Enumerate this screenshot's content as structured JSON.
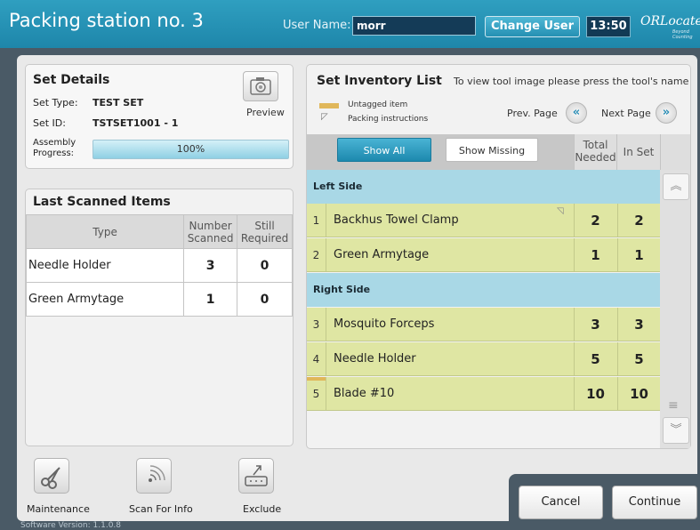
{
  "header": {
    "title": "Packing station no. 3",
    "user_label": "User Name:",
    "user_value": "morr",
    "change_user": "Change User",
    "time": "13:50",
    "logo": "ORLocate",
    "logo_sub": "Beyond Counting"
  },
  "set_details": {
    "title": "Set Details",
    "set_type_label": "Set Type:",
    "set_type_value": "TEST SET",
    "set_id_label": "Set ID:",
    "set_id_value": "TSTSET1001 - 1",
    "assembly_label_1": "Assembly",
    "assembly_label_2": "Progress:",
    "progress_text": "100%",
    "progress_value": 1.0,
    "preview_label": "Preview"
  },
  "last_scanned": {
    "title": "Last Scanned Items",
    "columns": {
      "type": "Type",
      "scanned_1": "Number",
      "scanned_2": "Scanned",
      "required_1": "Still",
      "required_2": "Required"
    },
    "rows": [
      {
        "type": "Needle Holder",
        "scanned": "3",
        "required": "0"
      },
      {
        "type": "Green Armytage",
        "scanned": "1",
        "required": "0"
      }
    ]
  },
  "inventory": {
    "title": "Set Inventory List",
    "hint": "To view tool image please press the tool's name",
    "legend_untagged": "Untagged item",
    "legend_packing": "Packing instructions",
    "prev_page": "Prev. Page",
    "next_page": "Next Page",
    "show_all": "Show All",
    "show_missing": "Show Missing",
    "col_total_1": "Total",
    "col_total_2": "Needed",
    "col_in_set": "In Set",
    "sections": [
      {
        "name": "Left Side"
      },
      {
        "name": "Right Side"
      }
    ],
    "items": [
      {
        "idx": "1",
        "name": "Backhus Towel Clamp",
        "needed": "2",
        "in_set": "2"
      },
      {
        "idx": "2",
        "name": "Green Armytage",
        "needed": "1",
        "in_set": "1"
      },
      {
        "idx": "3",
        "name": "Mosquito Forceps",
        "needed": "3",
        "in_set": "3"
      },
      {
        "idx": "4",
        "name": "Needle Holder",
        "needed": "5",
        "in_set": "5"
      },
      {
        "idx": "5",
        "name": "Blade #10",
        "needed": "10",
        "in_set": "10"
      }
    ]
  },
  "tools": {
    "maintenance": "Maintenance",
    "scan_for_info": "Scan For Info",
    "exclude": "Exclude"
  },
  "actions": {
    "cancel": "Cancel",
    "continue": "Continue"
  },
  "version": "Software Version: 1.1.0.8",
  "colors": {
    "header": "#2f9fc0",
    "section_row": "#a9d8e6",
    "item_row": "#dfe6a3",
    "untagged_marker": "#e0b75a"
  }
}
